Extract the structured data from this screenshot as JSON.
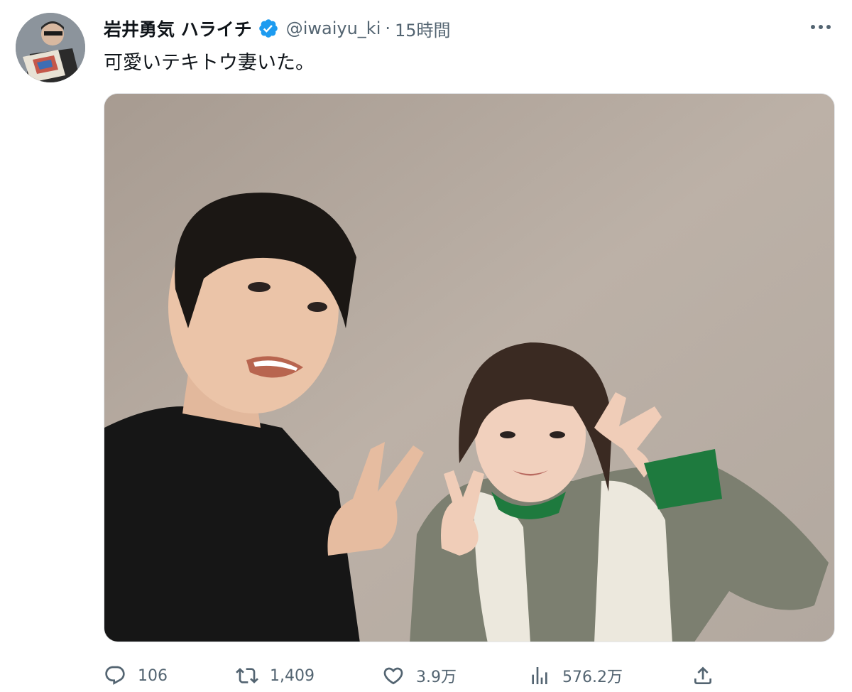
{
  "tweet": {
    "author_name": "岩井勇気 ハライチ",
    "handle": "@iwaiyu_ki",
    "separator": "·",
    "time": "15時間",
    "text": "可愛いテキトウ妻いた。"
  },
  "icons": {
    "verified": "verified-badge-icon",
    "more": "more-dots-icon",
    "reply": "reply-icon",
    "retweet": "retweet-icon",
    "like": "heart-icon",
    "views": "views-bar-icon",
    "share": "share-icon"
  },
  "metrics": {
    "replies": "106",
    "retweets": "1,409",
    "likes": "3.9万",
    "views": "576.2万"
  },
  "colors": {
    "text": "#0f1419",
    "secondary": "#536471",
    "verified": "#1d9bf0"
  }
}
